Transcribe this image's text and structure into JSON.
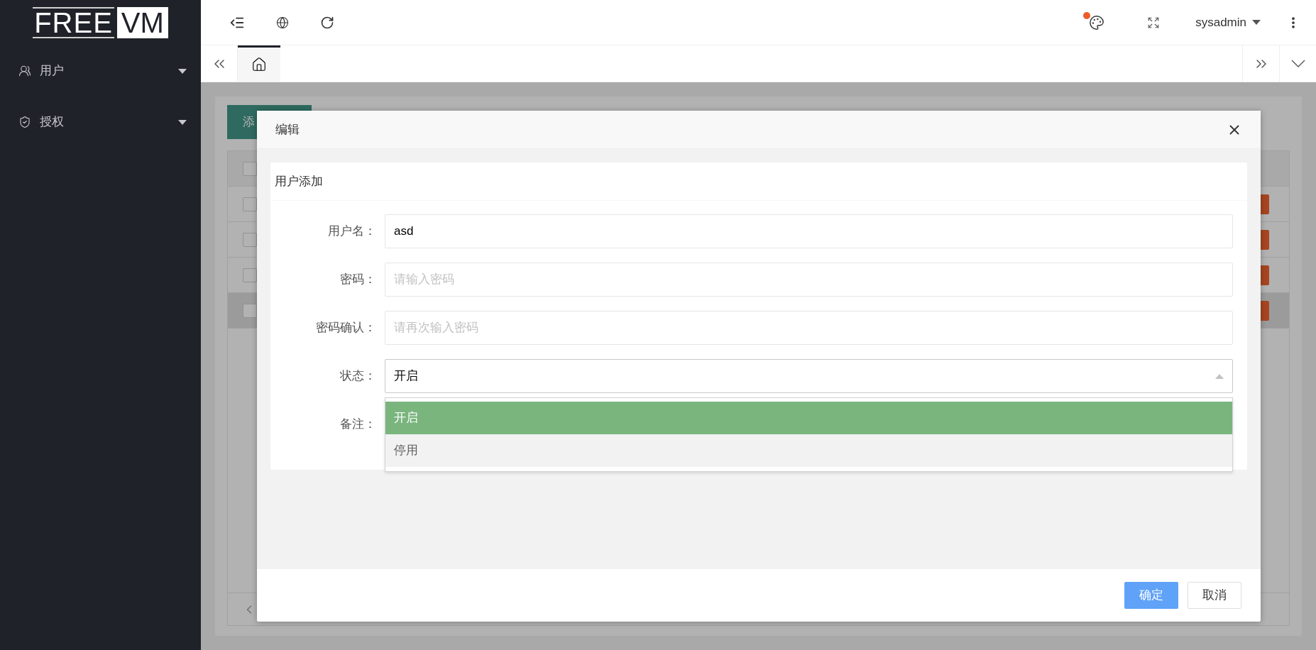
{
  "logo": {
    "left": "FREE",
    "right": "VM"
  },
  "sidebar": {
    "items": [
      {
        "label": "用户",
        "kind": "user"
      },
      {
        "label": "授权",
        "kind": "shield"
      }
    ]
  },
  "header": {
    "user": "sysadmin",
    "theme_dot": true
  },
  "tabs": [
    {
      "kind": "home",
      "selected": true
    }
  ],
  "background": {
    "add_button": "添",
    "header_checked": false,
    "rows": [
      {
        "highlighted": false,
        "checked": false
      },
      {
        "highlighted": false,
        "checked": false
      },
      {
        "highlighted": false,
        "checked": false
      },
      {
        "highlighted": true,
        "checked": false
      }
    ]
  },
  "dialog": {
    "title": "编辑",
    "card_title": "用户添加",
    "fields": [
      {
        "label": "用户名：",
        "kind": "text",
        "value": "asd"
      },
      {
        "label": "密码：",
        "kind": "text",
        "placeholder": "请输入密码"
      },
      {
        "label": "密码确认：",
        "kind": "text",
        "placeholder": "请再次输入密码"
      },
      {
        "label": "状态：",
        "kind": "select",
        "value": "开启",
        "expanded": true,
        "options": [
          {
            "label": "开启",
            "selected": true
          },
          {
            "label": "停用",
            "selected": false
          }
        ]
      },
      {
        "label": "备注：",
        "kind": "covered"
      }
    ],
    "buttons": [
      {
        "label": "确定",
        "kind": "primary"
      },
      {
        "label": "取消",
        "kind": "default"
      }
    ]
  }
}
